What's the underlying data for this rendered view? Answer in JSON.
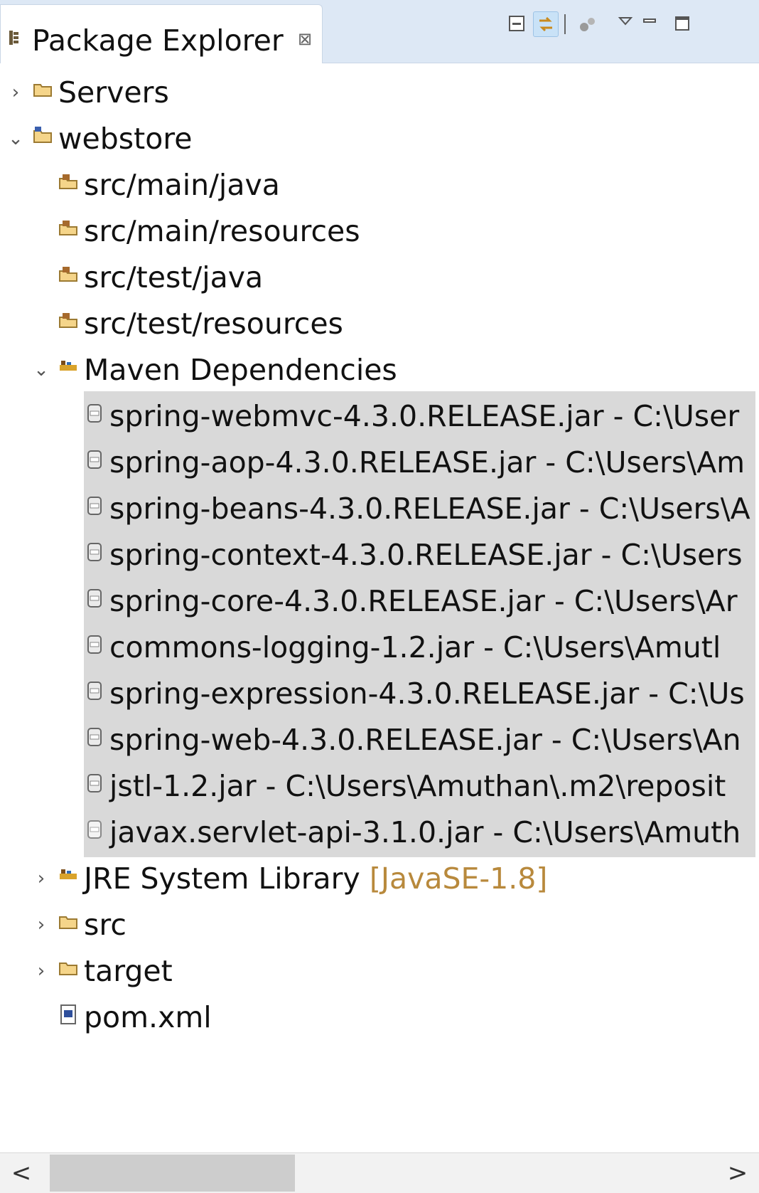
{
  "view": {
    "title": "Package Explorer",
    "close_glyph": "⊠",
    "toolbar": [
      "collapse-all-icon",
      "link-with-editor-icon",
      "focus-on-active-task-icon",
      "view-menu-icon",
      "minimize-icon",
      "maximize-icon"
    ]
  },
  "tree": {
    "servers": "Servers",
    "webstore": "webstore",
    "src_main_java": "src/main/java",
    "src_main_resources": "src/main/resources",
    "src_test_java": "src/test/java",
    "src_test_resources": "src/test/resources",
    "maven_dependencies": "Maven Dependencies",
    "jars": [
      "spring-webmvc-4.3.0.RELEASE.jar - C:\\User",
      "spring-aop-4.3.0.RELEASE.jar - C:\\Users\\Am",
      "spring-beans-4.3.0.RELEASE.jar - C:\\Users\\A",
      "spring-context-4.3.0.RELEASE.jar - C:\\Users",
      "spring-core-4.3.0.RELEASE.jar - C:\\Users\\Ar",
      "commons-logging-1.2.jar - C:\\Users\\Amutl",
      "spring-expression-4.3.0.RELEASE.jar - C:\\Us",
      "spring-web-4.3.0.RELEASE.jar - C:\\Users\\An",
      "jstl-1.2.jar - C:\\Users\\Amuthan\\.m2\\reposit",
      "javax.servlet-api-3.1.0.jar - C:\\Users\\Amuth"
    ],
    "jre_label": "JRE System Library",
    "jre_decor": "[JavaSE-1.8]",
    "src": "src",
    "target": "target",
    "pom": "pom.xml"
  },
  "scrollbar": {
    "left": "<",
    "right": ">"
  },
  "colors": {
    "selection": "#d9d9d9",
    "tab_bar": "#dde8f5",
    "decoration": "#b8893c"
  }
}
